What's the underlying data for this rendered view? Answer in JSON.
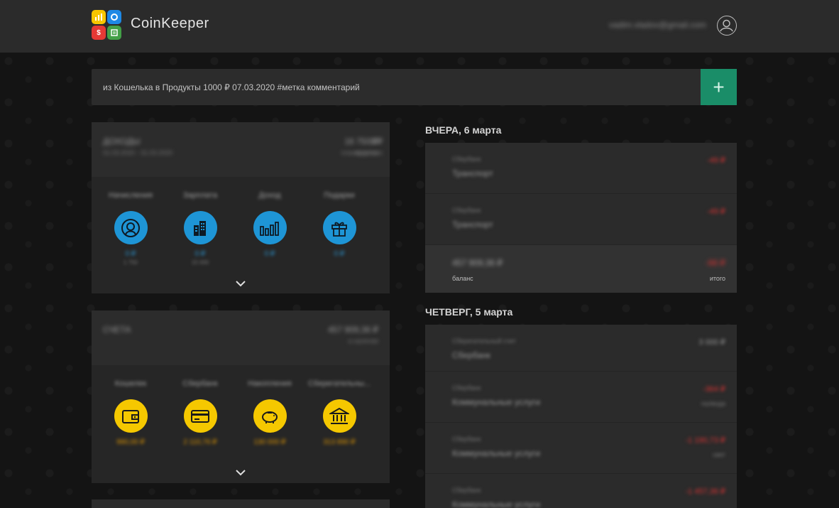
{
  "header": {
    "brand": "CoinKeeper",
    "email": "vadim.vladov@gmail.com"
  },
  "quick_add": {
    "placeholder": "из Кошелька в Продукты 1000 ₽ 07.03.2020 #метка комментарий",
    "add_symbol": "+"
  },
  "income_panel": {
    "title": "ДОХОДЫ",
    "period": "01.03.2020 - 31.03.2020",
    "value1": "0 ₽",
    "value1_label": "получено",
    "value2": "16 750 ₽",
    "value2_label": "планируется",
    "items": [
      {
        "name": "Начисления",
        "value": "0 ₽",
        "sub": "1 750"
      },
      {
        "name": "Зарплата",
        "value": "0 ₽",
        "sub": "15 000"
      },
      {
        "name": "Доход",
        "value": "0 ₽",
        "sub": ""
      },
      {
        "name": "Подарки",
        "value": "0 ₽",
        "sub": ""
      }
    ]
  },
  "accounts_panel": {
    "title": "СЧЕТА",
    "value": "457 909,36 ₽",
    "value_label": "в наличии",
    "items": [
      {
        "name": "Кошелек",
        "value": "990,00 ₽"
      },
      {
        "name": "Сбербанк",
        "value": "2 110,76 ₽"
      },
      {
        "name": "Накопления",
        "value": "130 000 ₽"
      },
      {
        "name": "Сберегательны...",
        "value": "313 890 ₽"
      }
    ]
  },
  "feed": {
    "days": [
      {
        "heading": "ВЧЕРА, 6 марта",
        "transactions": [
          {
            "from": "Сбербанк",
            "to": "Транспорт",
            "amount": "-49 ₽",
            "tag": ""
          },
          {
            "from": "Сбербанк",
            "to": "Транспорт",
            "amount": "-49 ₽",
            "tag": ""
          }
        ],
        "summary": {
          "balance": "457 909,36 ₽",
          "balance_label": "баланс",
          "total": "-98 ₽",
          "total_label": "итого"
        }
      },
      {
        "heading": "ЧЕТВЕРГ, 5 марта",
        "transactions": [
          {
            "from": "Сберегательный счет",
            "to": "Сбербанк",
            "amount": "3 000 ₽",
            "tag": ""
          },
          {
            "from": "Сбербанк",
            "to": "Коммунальные услуги",
            "amount": "-364 ₽",
            "tag": "газ/вода"
          },
          {
            "from": "Сбербанк",
            "to": "Коммунальные услуги",
            "amount": "-1 190,73 ₽",
            "tag": "свет"
          },
          {
            "from": "Сбербанк",
            "to": "Коммунальные услуги",
            "amount": "-1 457,36 ₽",
            "tag": ""
          }
        ]
      }
    ]
  },
  "colors": {
    "accent_green": "#1a8d68",
    "income_blue": "#1e95d6",
    "account_yellow": "#f5c800",
    "expense_red": "#d33333"
  }
}
